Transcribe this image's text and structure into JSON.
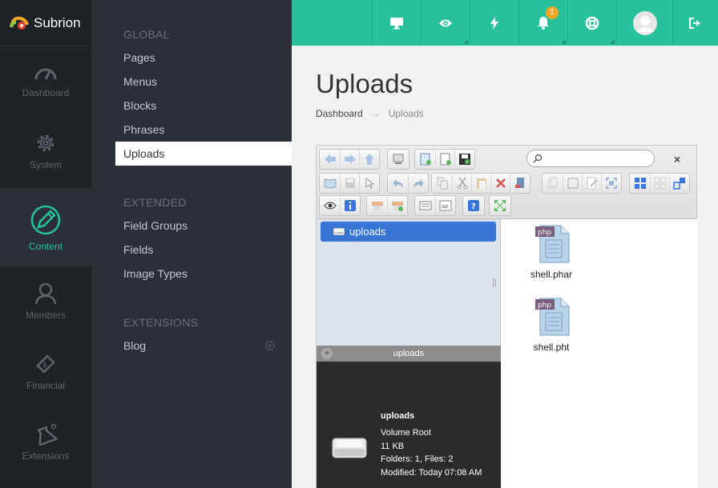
{
  "brand": {
    "name": "Subrion"
  },
  "rail": [
    {
      "label": "Dashboard",
      "icon": "dashboard-gauge-icon"
    },
    {
      "label": "System",
      "icon": "gear-icon"
    },
    {
      "label": "Content",
      "icon": "pencil-icon"
    },
    {
      "label": "Members",
      "icon": "user-icon"
    },
    {
      "label": "Financial",
      "icon": "money-tag-icon"
    },
    {
      "label": "Extensions",
      "icon": "flask-icon"
    }
  ],
  "submenu": {
    "global_heading": "GLOBAL",
    "global_items": [
      "Pages",
      "Menus",
      "Blocks",
      "Phrases",
      "Uploads"
    ],
    "extended_heading": "EXTENDED",
    "extended_items": [
      "Field Groups",
      "Fields",
      "Image Types"
    ],
    "extensions_heading": "EXTENSIONS",
    "extensions_items": [
      "Blog"
    ]
  },
  "topbar": {
    "notifications_count": "1",
    "icons": [
      "monitor-icon",
      "eye-icon",
      "bolt-icon",
      "bell-icon",
      "lifebuoy-icon",
      "avatar",
      "logout-icon"
    ]
  },
  "page": {
    "title": "Uploads",
    "breadcrumb": {
      "home": "Dashboard",
      "separator": "→",
      "current": "Uploads"
    }
  },
  "filemanager": {
    "search_value": "",
    "close_label": "×",
    "tree_root": "uploads",
    "splitter": "||",
    "files": [
      {
        "name": "shell.phar",
        "type": "php"
      },
      {
        "name": "shell.pht",
        "type": "php"
      }
    ],
    "info": {
      "header": "uploads",
      "plus": "+",
      "name": "uploads",
      "kind": "Volume Root",
      "size": "11 KB",
      "counts": "Folders: 1, Files: 2",
      "modified": "Modified: Today 07:08 AM"
    }
  },
  "colors": {
    "accent": "#27c19c",
    "rail_bg": "#1f2227",
    "submenu_bg": "#2b2f36",
    "selection": "#3875d7"
  }
}
